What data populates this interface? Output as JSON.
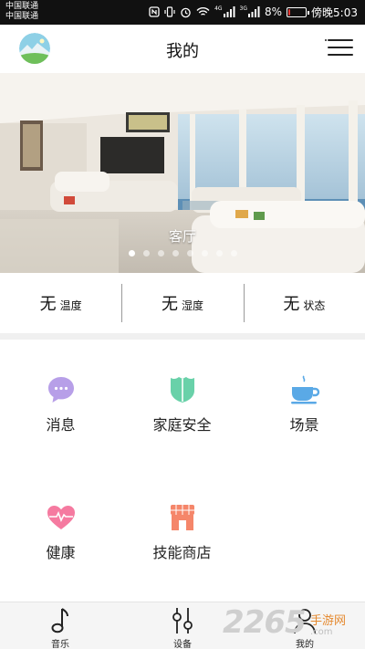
{
  "status_bar": {
    "carrier_1": "中国联通",
    "carrier_2": "中国联通",
    "network_1": "4G",
    "network_2": "3G",
    "battery_text": "8%",
    "battery_level": 0.08,
    "battery_color": "#e53935",
    "time": "傍晚5:03",
    "icons": [
      "nfc-icon",
      "vibrate-icon",
      "alarm-icon",
      "wifi-icon",
      "signal-icon",
      "signal-icon",
      "battery-icon"
    ]
  },
  "header": {
    "title": "我的",
    "avatar_icon": "avatar-landscape-icon",
    "menu_icon": "menu-icon"
  },
  "banner": {
    "caption": "客厅",
    "slide_count": 8,
    "active_index": 0
  },
  "readings": [
    {
      "value": "无",
      "label": "温度"
    },
    {
      "value": "无",
      "label": "湿度"
    },
    {
      "value": "无",
      "label": "状态"
    }
  ],
  "grid": [
    {
      "label": "消息",
      "icon": "chat-bubble-icon",
      "color": "#b79fe8"
    },
    {
      "label": "家庭安全",
      "icon": "shield-icon",
      "color": "#69d1a9"
    },
    {
      "label": "场景",
      "icon": "coffee-cup-icon",
      "color": "#5aa9e6"
    },
    {
      "label": "健康",
      "icon": "heart-pulse-icon",
      "color": "#f57aa0"
    },
    {
      "label": "技能商店",
      "icon": "store-icon",
      "color": "#f5866a"
    }
  ],
  "tabs": [
    {
      "label": "音乐",
      "icon": "music-note-icon"
    },
    {
      "label": "设备",
      "icon": "sliders-icon"
    },
    {
      "label": "我的",
      "icon": "profile-icon"
    }
  ],
  "watermark": {
    "number": "2265",
    "text": "手游网",
    "url": ".com"
  }
}
